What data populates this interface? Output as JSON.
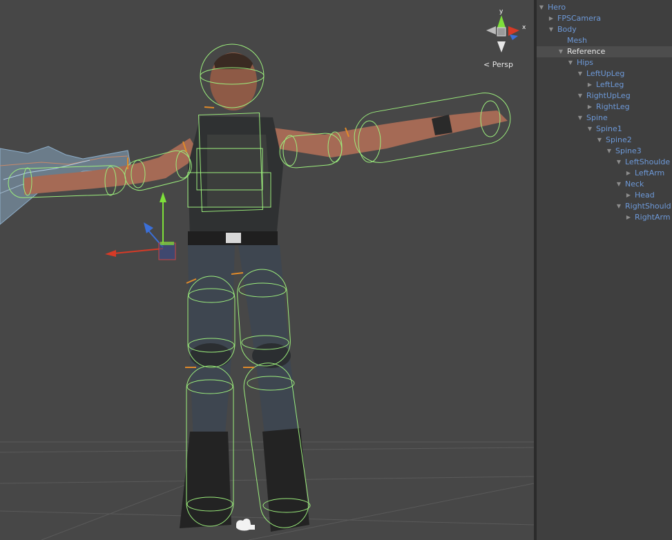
{
  "viewport": {
    "projection_label": "Persp",
    "axis_y_label": "y",
    "axis_x_label": "x"
  },
  "hierarchy": {
    "items": [
      {
        "label": "Hero",
        "expanded": true
      },
      {
        "label": "FPSCamera",
        "expanded": false
      },
      {
        "label": "Body",
        "expanded": true
      },
      {
        "label": "Mesh"
      },
      {
        "label": "Reference",
        "expanded": true,
        "selected": true
      },
      {
        "label": "Hips",
        "expanded": true
      },
      {
        "label": "LeftUpLeg",
        "expanded": true
      },
      {
        "label": "LeftLeg",
        "expanded": false
      },
      {
        "label": "RightUpLeg",
        "expanded": true
      },
      {
        "label": "RightLeg",
        "expanded": false
      },
      {
        "label": "Spine",
        "expanded": true
      },
      {
        "label": "Spine1",
        "expanded": true
      },
      {
        "label": "Spine2",
        "expanded": true
      },
      {
        "label": "Spine3",
        "expanded": true
      },
      {
        "label": "LeftShoulde",
        "expanded": true
      },
      {
        "label": "LeftArm",
        "expanded": false
      },
      {
        "label": "Neck",
        "expanded": true
      },
      {
        "label": "Head",
        "expanded": false
      },
      {
        "label": "RightShould",
        "expanded": true
      },
      {
        "label": "RightArm",
        "expanded": false
      }
    ]
  },
  "colors": {
    "hierarchy_text": "#6d99d8",
    "selected_text": "#e9e9e9",
    "collider_green": "#9df07d",
    "axis_x": "#d63a26",
    "axis_y": "#7ee03a",
    "axis_z": "#3b6fd8"
  }
}
